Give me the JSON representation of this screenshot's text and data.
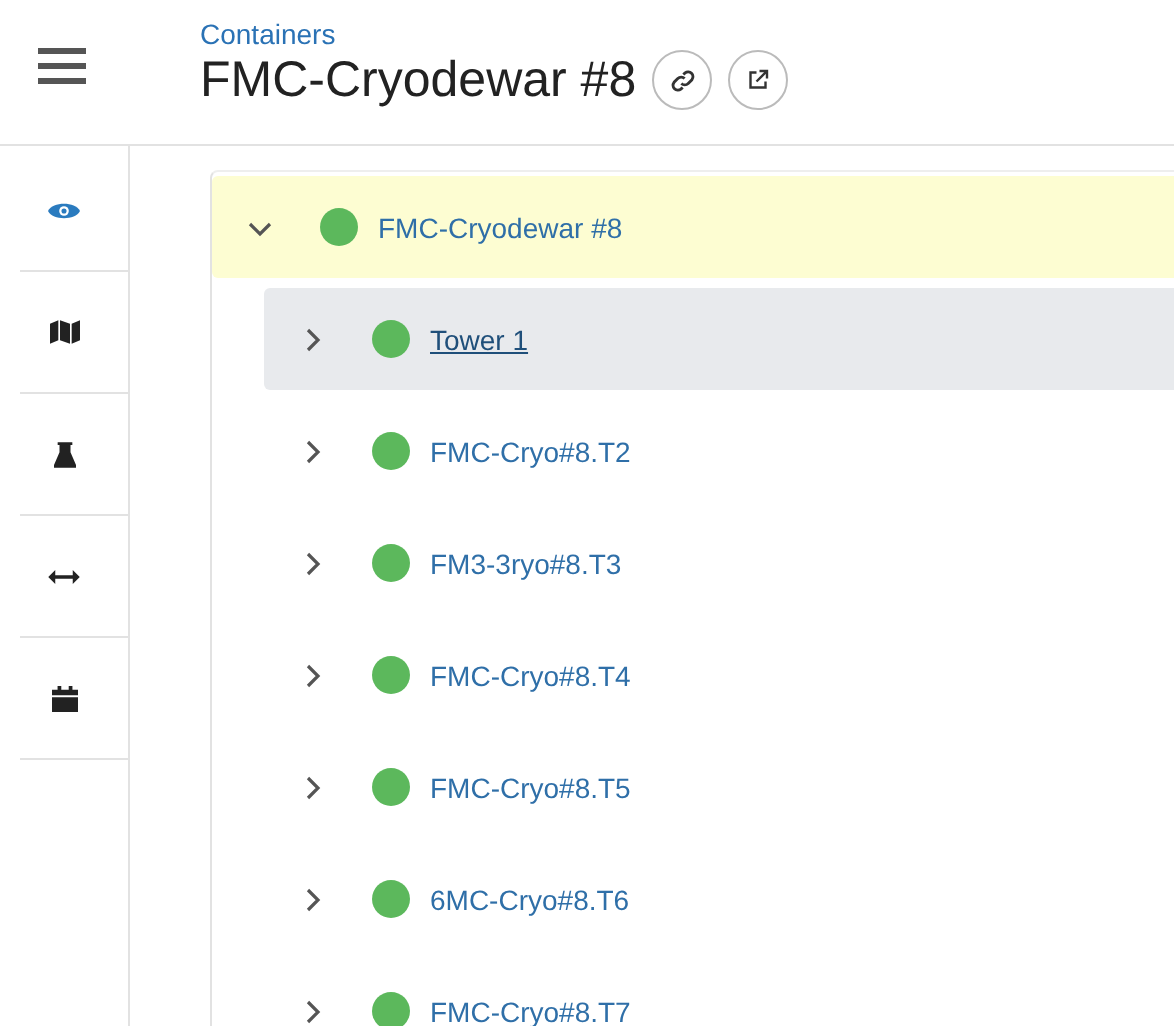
{
  "header": {
    "breadcrumb": "Containers",
    "title": "FMC-Cryodewar #8"
  },
  "rail": [
    {
      "kind": "eye",
      "selected": true
    },
    {
      "kind": "map",
      "selected": false
    },
    {
      "kind": "flask",
      "selected": false
    },
    {
      "kind": "arrows",
      "selected": false
    },
    {
      "kind": "calendar",
      "selected": false
    }
  ],
  "tree": {
    "label": "FMC-Cryodewar #8",
    "expanded": true,
    "highlighted": true,
    "selected": false,
    "children": [
      {
        "label": "Tower 1",
        "expanded": false,
        "highlighted": false,
        "selected": true
      },
      {
        "label": "FMC-Cryo#8.T2",
        "expanded": false,
        "highlighted": false,
        "selected": false
      },
      {
        "label": "FM3-3ryo#8.T3",
        "expanded": false,
        "highlighted": false,
        "selected": false
      },
      {
        "label": "FMC-Cryo#8.T4",
        "expanded": false,
        "highlighted": false,
        "selected": false
      },
      {
        "label": "FMC-Cryo#8.T5",
        "expanded": false,
        "highlighted": false,
        "selected": false
      },
      {
        "label": "6MC-Cryo#8.T6",
        "expanded": false,
        "highlighted": false,
        "selected": false
      },
      {
        "label": "FMC-Cryo#8.T7",
        "expanded": false,
        "highlighted": false,
        "selected": false
      }
    ]
  }
}
